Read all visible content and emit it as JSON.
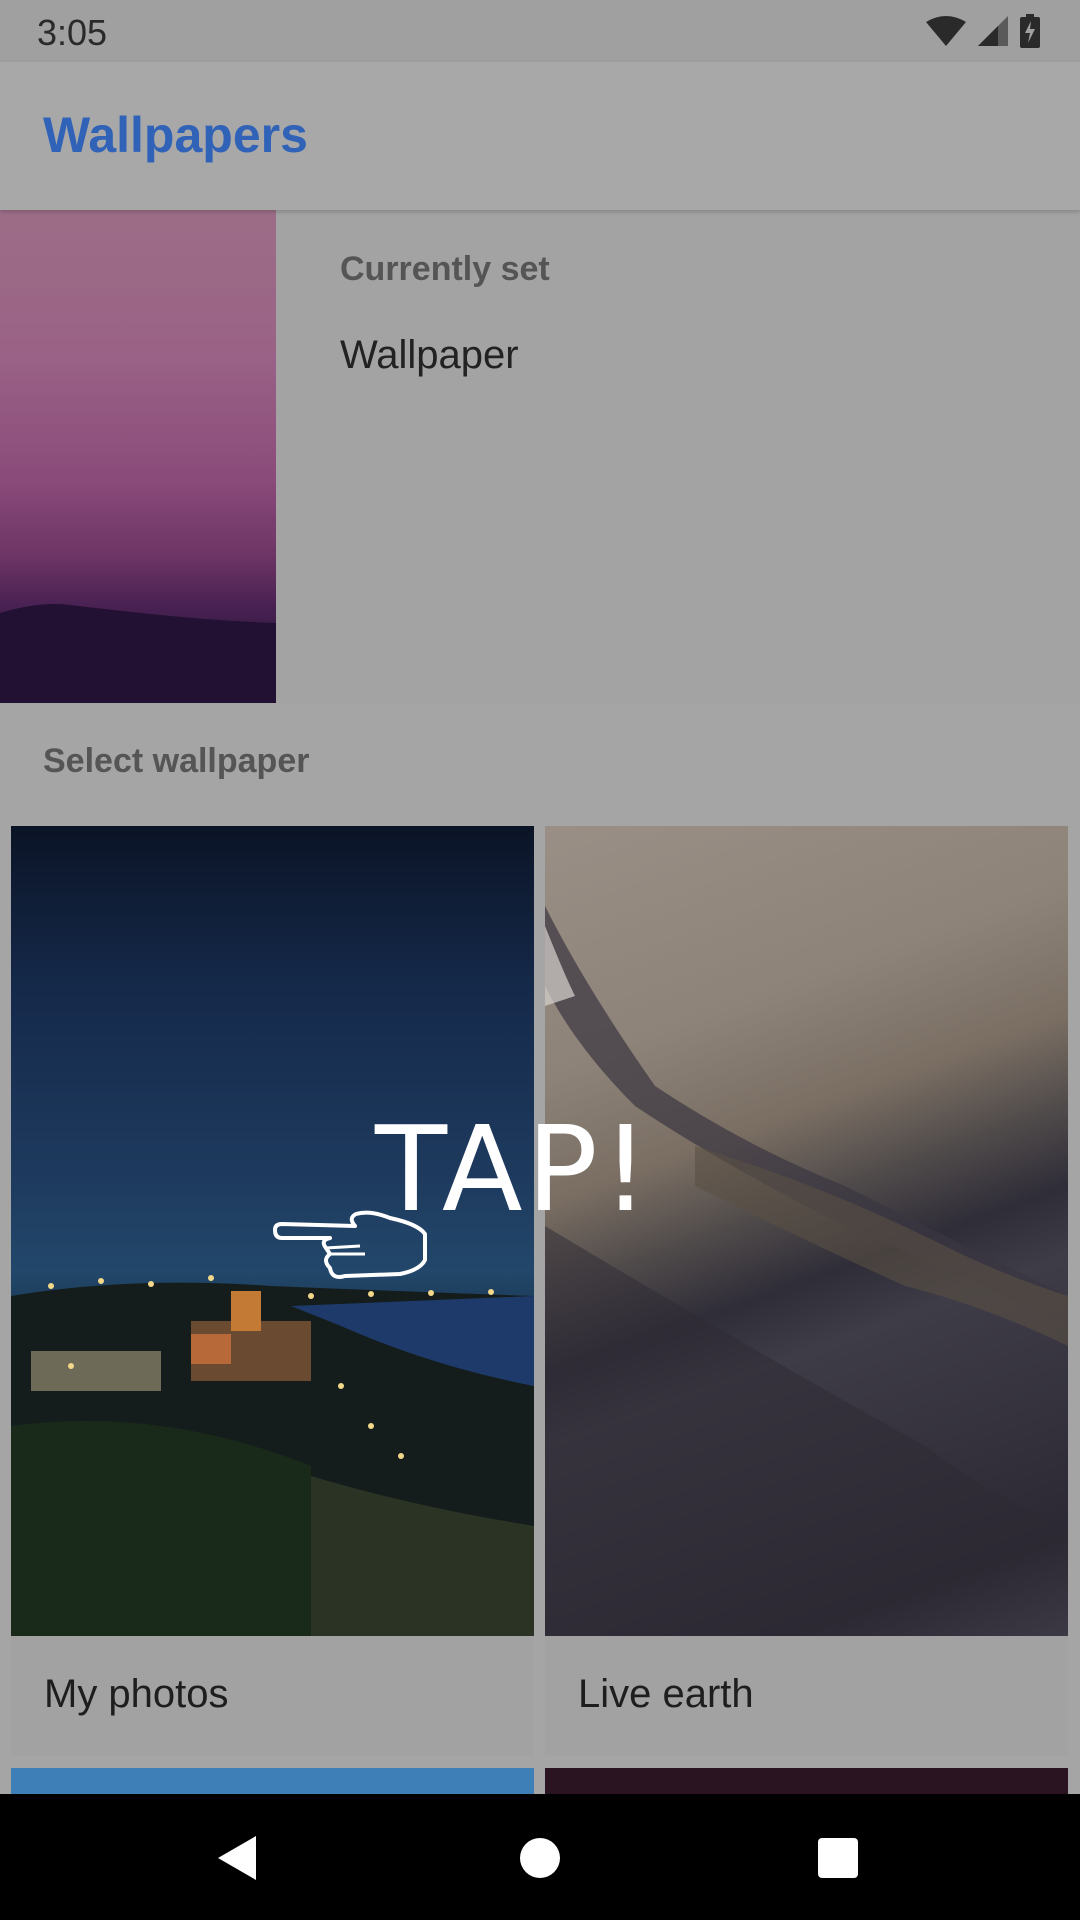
{
  "status_bar": {
    "time": "3:05"
  },
  "app_bar": {
    "title": "Wallpapers"
  },
  "current": {
    "label": "Currently set",
    "name": "Wallpaper"
  },
  "select": {
    "header": "Select wallpaper"
  },
  "tiles": [
    {
      "label": "My photos"
    },
    {
      "label": "Live earth"
    }
  ],
  "overlay": {
    "tap_text": "TAP!",
    "icon": "pointing-hand-icon"
  },
  "nav": [
    "back-icon",
    "home-icon",
    "recents-icon"
  ],
  "colors": {
    "title": "#3063b8",
    "nav_background": "#000000"
  }
}
